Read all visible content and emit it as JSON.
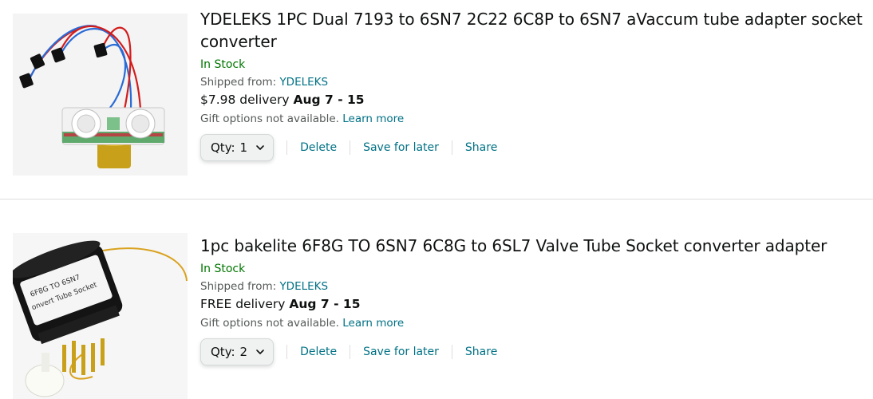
{
  "items": [
    {
      "title": "YDELEKS 1PC Dual 7193 to 6SN7 2C22 6C8P to 6SN7 aVaccum tube adapter socket converter",
      "stock": "In Stock",
      "shipped_label": "Shipped from: ",
      "seller": "YDELEKS",
      "delivery_price": "$7.98 delivery ",
      "delivery_date": "Aug 7 - 15",
      "gift_text": "Gift options not available. ",
      "learn_more": "Learn more",
      "qty_label": "Qty:",
      "qty_value": "1",
      "delete_label": "Delete",
      "save_label": "Save for later",
      "share_label": "Share"
    },
    {
      "title": "1pc bakelite 6F8G TO 6SN7 6C8G to 6SL7 Valve Tube Socket converter adapter",
      "stock": "In Stock",
      "shipped_label": "Shipped from: ",
      "seller": "YDELEKS",
      "delivery_price": "FREE delivery ",
      "delivery_date": "Aug 7 - 15",
      "gift_text": "Gift options not available. ",
      "learn_more": "Learn more",
      "qty_label": "Qty:",
      "qty_value": "2",
      "delete_label": "Delete",
      "save_label": "Save for later",
      "share_label": "Share"
    }
  ],
  "images": {
    "label_lines": [
      "6F8G TO 6SN7",
      "onvert Tube Socket"
    ]
  },
  "colors": {
    "in_stock": "#007600",
    "link": "#007185",
    "secondary_text": "#565959"
  }
}
